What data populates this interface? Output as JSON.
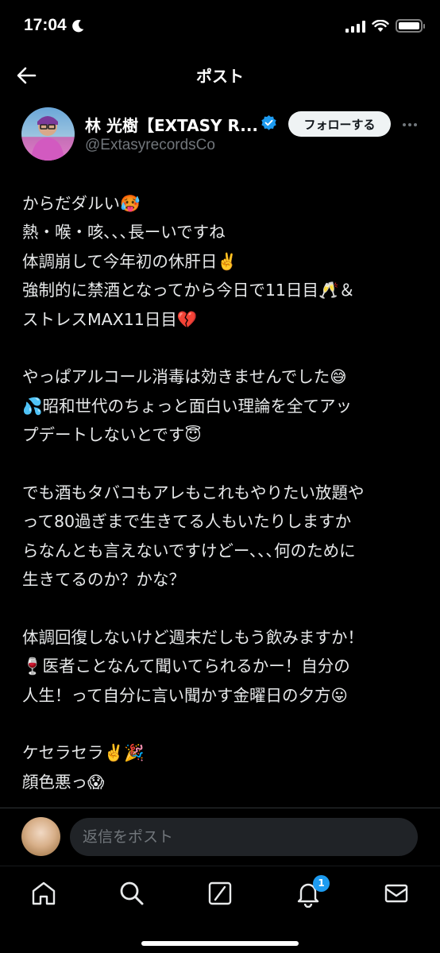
{
  "status_bar": {
    "time": "17:04"
  },
  "header": {
    "title": "ポスト"
  },
  "author": {
    "name": "林 光樹【EXTASY R...",
    "handle": "@ExtasyrecordsCo",
    "follow_label": "フォローする"
  },
  "post": {
    "lines": [
      "からだダルい🥵",
      "熱・喉・咳､､､長ーいですね",
      "体調崩して今年初の休肝日✌️",
      "強制的に禁酒となってから今日で11日目🥂＆",
      "ストレスMAX11日目💔",
      "",
      "やっぱアルコール消毒は効きませんでした😅",
      "💦昭和世代のちょっと面白い理論を全てアッ",
      "プデートしないとです😇",
      "",
      "でも酒もタバコもアレもこれもやりたい放題や",
      "って80過ぎまで生きてる人もいたりしますか",
      "らなんとも言えないですけどー､､､何のために",
      "生きてるのか？かな？",
      "",
      "体調回復しないけど週末だしもう飲みますか！",
      "🍷医者ことなんて聞いてられるかー！自分の",
      "人生！って自分に言い聞かす金曜日の夕方😛",
      "",
      "ケセラセラ✌️🎉",
      "顔色悪っ😱"
    ]
  },
  "reply": {
    "placeholder": "返信をポスト"
  },
  "tabs": {
    "notifications_badge": "1"
  },
  "colors": {
    "background": "#000000",
    "text": "#e7e9ea",
    "muted": "#71767b",
    "accent": "#1d9bf0"
  },
  "icons": [
    "back-arrow-icon",
    "verified-badge-icon",
    "more-icon",
    "home-icon",
    "search-icon",
    "grok-icon",
    "bell-icon",
    "mail-icon"
  ]
}
